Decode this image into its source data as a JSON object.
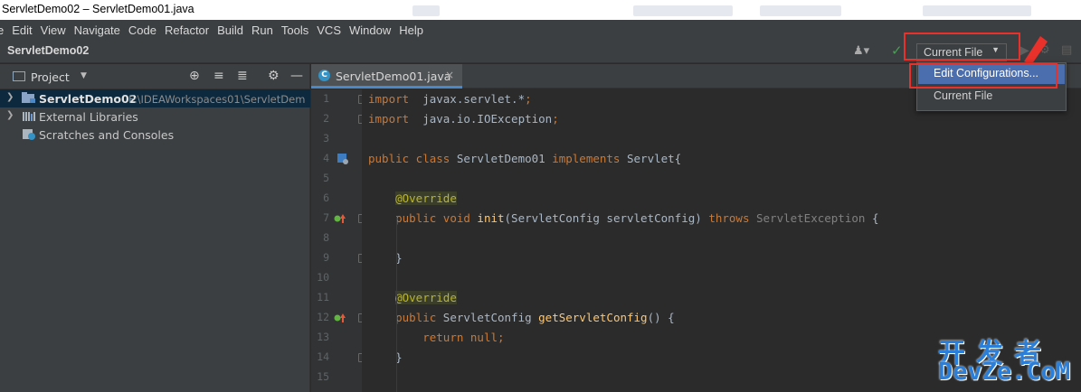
{
  "window": {
    "title": "ServletDemo02 – ServletDemo01.java"
  },
  "menu": [
    "e",
    "Edit",
    "View",
    "Navigate",
    "Code",
    "Refactor",
    "Build",
    "Run",
    "Tools",
    "VCS",
    "Window",
    "Help"
  ],
  "navbar": {
    "project": "ServletDemo02",
    "run_config": "Current File",
    "popup_items": [
      "Edit Configurations...",
      "Current File"
    ]
  },
  "project_panel": {
    "title": "Project",
    "tree": [
      {
        "label": "ServletDemo02",
        "path": "F:\\IDEAWorkspaces01\\ServletDem"
      },
      {
        "label": "External Libraries"
      },
      {
        "label": "Scratches and Consoles"
      }
    ]
  },
  "editor": {
    "tab": "ServletDemo01.java",
    "lines": [
      {
        "no": "1",
        "tokens": [
          [
            "kw",
            "import"
          ],
          [
            "",
            "  javax.servlet.*"
          ],
          [
            "kw",
            ";"
          ]
        ]
      },
      {
        "no": "2",
        "tokens": [
          [
            "kw",
            "import"
          ],
          [
            "",
            "  java.io.IOException"
          ],
          [
            "kw",
            ";"
          ]
        ]
      },
      {
        "no": "3",
        "tokens": []
      },
      {
        "no": "4",
        "tokens": [
          [
            "kw",
            "public class "
          ],
          [
            "",
            "ServletDemo01 "
          ],
          [
            "kw",
            "implements "
          ],
          [
            "",
            "Servlet{"
          ]
        ]
      },
      {
        "no": "5",
        "tokens": []
      },
      {
        "no": "6",
        "tokens": [
          [
            "",
            "    "
          ],
          [
            "ann",
            "@Override"
          ]
        ]
      },
      {
        "no": "7",
        "tokens": [
          [
            "",
            "    "
          ],
          [
            "kw",
            "public void "
          ],
          [
            "fn",
            "init"
          ],
          [
            "",
            "(ServletConfig servletConfig) "
          ],
          [
            "kw",
            "throws "
          ],
          [
            "gr",
            "ServletException "
          ],
          [
            "",
            "{"
          ]
        ]
      },
      {
        "no": "8",
        "tokens": []
      },
      {
        "no": "9",
        "tokens": [
          [
            "",
            "    }"
          ]
        ]
      },
      {
        "no": "10",
        "tokens": []
      },
      {
        "no": "11",
        "tokens": [
          [
            "",
            "    "
          ],
          [
            "ann",
            "@Override"
          ]
        ]
      },
      {
        "no": "12",
        "tokens": [
          [
            "",
            "    "
          ],
          [
            "kw",
            "public "
          ],
          [
            "",
            "ServletConfig "
          ],
          [
            "fn",
            "getServletConfig"
          ],
          [
            "",
            "() {"
          ]
        ]
      },
      {
        "no": "13",
        "tokens": [
          [
            "",
            "        "
          ],
          [
            "kw",
            "return null"
          ],
          [
            "kw",
            ";"
          ]
        ]
      },
      {
        "no": "14",
        "tokens": [
          [
            "",
            "    }"
          ]
        ]
      },
      {
        "no": "15",
        "tokens": []
      }
    ]
  },
  "watermark": {
    "line1": "开发者",
    "line2": "DevZe.CoM"
  },
  "colors": {
    "accent": "#4b6eaf",
    "highlight_box": "#e8312a",
    "keyword": "#cc7832",
    "annotation": "#bbb529",
    "function": "#ffc66d"
  }
}
